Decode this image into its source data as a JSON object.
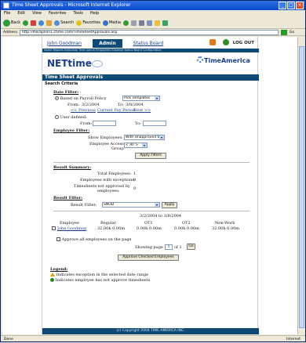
{
  "window": {
    "title": "Time Sheet Approvals - Microsoft Internet Explorer",
    "controls": [
      "_",
      "□",
      "×"
    ]
  },
  "menu": [
    "File",
    "Edit",
    "View",
    "Favorites",
    "Tools",
    "Help"
  ],
  "toolbar": {
    "back": "Back",
    "search": "Search",
    "favorites": "Favorites",
    "media": "Media"
  },
  "address": {
    "label": "Address",
    "url": "http://lharaplion1.ctime.com/TimeSheetApprovals.asp",
    "go": "Go"
  },
  "nav": {
    "user": "John Goodman",
    "admin": "Admin",
    "status_board": "Status Board",
    "logout": "LOG OUT",
    "subnav": "Home  Reports  Individual Time  Admin  Employees  Expense  Status  Board  Configuration"
  },
  "logo": {
    "product": "NETtime",
    "brand": "TimeAmerica"
  },
  "page_title": "Time Sheet Approvals",
  "search_criteria": "Search Criteria",
  "date_filter": {
    "heading": "Date Filter:",
    "based_on_label": "Based on Payroll Policy",
    "policy_value": "Pick Templates",
    "from_label": "From:",
    "from_value": "3/2/2004",
    "to_label": "To:",
    "to_value": "3/8/2004",
    "prev": "<< Previous",
    "current": "Current Pay Period",
    "next": "Next >>",
    "user_defined_label": "User defined:",
    "ud_from_label": "From:",
    "ud_to_label": "To:"
  },
  "employee_filter": {
    "heading": "Employee Filter:",
    "show_label": "Show Employees:",
    "show_value": "With Unapproved time",
    "access_label": "Employee Access",
    "access_label2": "Group",
    "access_value": "< All >",
    "apply": "Apply Filters"
  },
  "result_summary": {
    "heading": "Result Summary:",
    "total_label": "Total Employees:",
    "total_value": "1",
    "exceptions_label": "Employees with exceptions:",
    "exceptions_value": "0",
    "not_approved_label": "Timesheets not approved by",
    "not_approved_label2": "employees:",
    "not_approved_value": "0"
  },
  "result_filter": {
    "heading": "Result Filter:",
    "label": "Result Filter:",
    "value": "SNOD",
    "apply": "Apply"
  },
  "table": {
    "period": "3/2/2004 to 3/8/2004",
    "headers": [
      "Employee",
      "Regular",
      "OT1",
      "OT2",
      "Non-Work"
    ],
    "rows": [
      {
        "employee": "John Goodman",
        "regular": "32.00h 0.00m",
        "ot1": "0.00h 0.00m",
        "ot2": "0.00h 0.00m",
        "nonwork": "32.00h 0.00m"
      }
    ]
  },
  "approve_all": "Approve all employees on the page",
  "paging": {
    "label": "Showing page",
    "page": "1",
    "of": "of 1",
    "go": "Go"
  },
  "approve_checked": "Approve Checked Employees",
  "legend": {
    "heading": "Legend:",
    "items": [
      "Indicates exception in the selected date range",
      "Indicates employee has not approve timesheets"
    ]
  },
  "footer": "(c) Copyright 2004 TIME AMERICA INC.",
  "status": {
    "left": "Done",
    "right": "Internet"
  }
}
